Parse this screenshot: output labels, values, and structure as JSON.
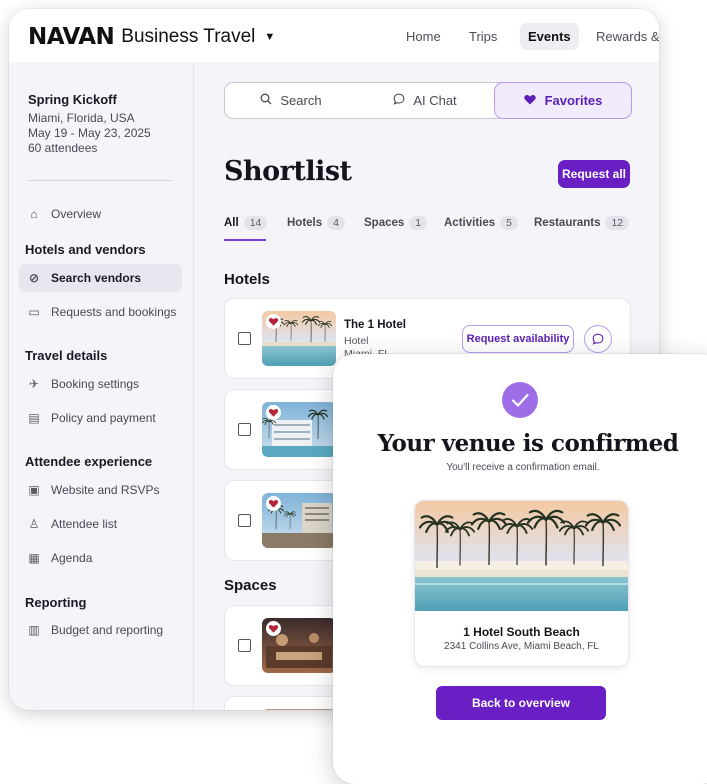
{
  "brand": {
    "logo_text": "NAVAN",
    "product": "Business Travel"
  },
  "nav": {
    "items": [
      "Home",
      "Trips",
      "Events",
      "Rewards &"
    ],
    "active": "Events"
  },
  "event": {
    "name": "Spring Kickoff",
    "location": "Miami, Florida, USA",
    "dates": "May 19 - May 23, 2025",
    "attendees": "60 attendees"
  },
  "sidebar": {
    "overview": "Overview",
    "sections": [
      {
        "heading": "Hotels and vendors",
        "items": [
          "Search vendors",
          "Requests and bookings"
        ]
      },
      {
        "heading": "Travel details",
        "items": [
          "Booking settings",
          "Policy and payment"
        ]
      },
      {
        "heading": "Attendee experience",
        "items": [
          "Website and RSVPs",
          "Attendee list",
          "Agenda"
        ]
      },
      {
        "heading": "Reporting",
        "items": [
          "Budget and reporting"
        ]
      }
    ],
    "active_item": "Search vendors"
  },
  "segmented": {
    "search": "Search",
    "ai_chat": "AI Chat",
    "favorites": "Favorites",
    "active": "Favorites"
  },
  "page": {
    "title": "Shortlist",
    "request_all": "Request all"
  },
  "tabs": [
    {
      "label": "All",
      "count": "14"
    },
    {
      "label": "Hotels",
      "count": "4"
    },
    {
      "label": "Spaces",
      "count": "1"
    },
    {
      "label": "Activities",
      "count": "5"
    },
    {
      "label": "Restaurants",
      "count": "12"
    }
  ],
  "active_tab": "All",
  "sections": {
    "hotels": "Hotels",
    "spaces": "Spaces"
  },
  "hotel_card": {
    "name": "The 1 Hotel",
    "type": "Hotel",
    "location": "Miami, FL",
    "request_button": "Request availability"
  },
  "modal": {
    "title": "Your venue is confirmed",
    "subtitle": "You'll receive a confirmation email.",
    "venue_name": "1 Hotel South Beach",
    "venue_address": "2341 Collins Ave, Miami Beach, FL",
    "button": "Back to overview"
  },
  "colors": {
    "accent": "#6a1fc4",
    "accent_light": "#f1ebfd",
    "check": "#9d6ee8",
    "heart": "#b5253a"
  }
}
